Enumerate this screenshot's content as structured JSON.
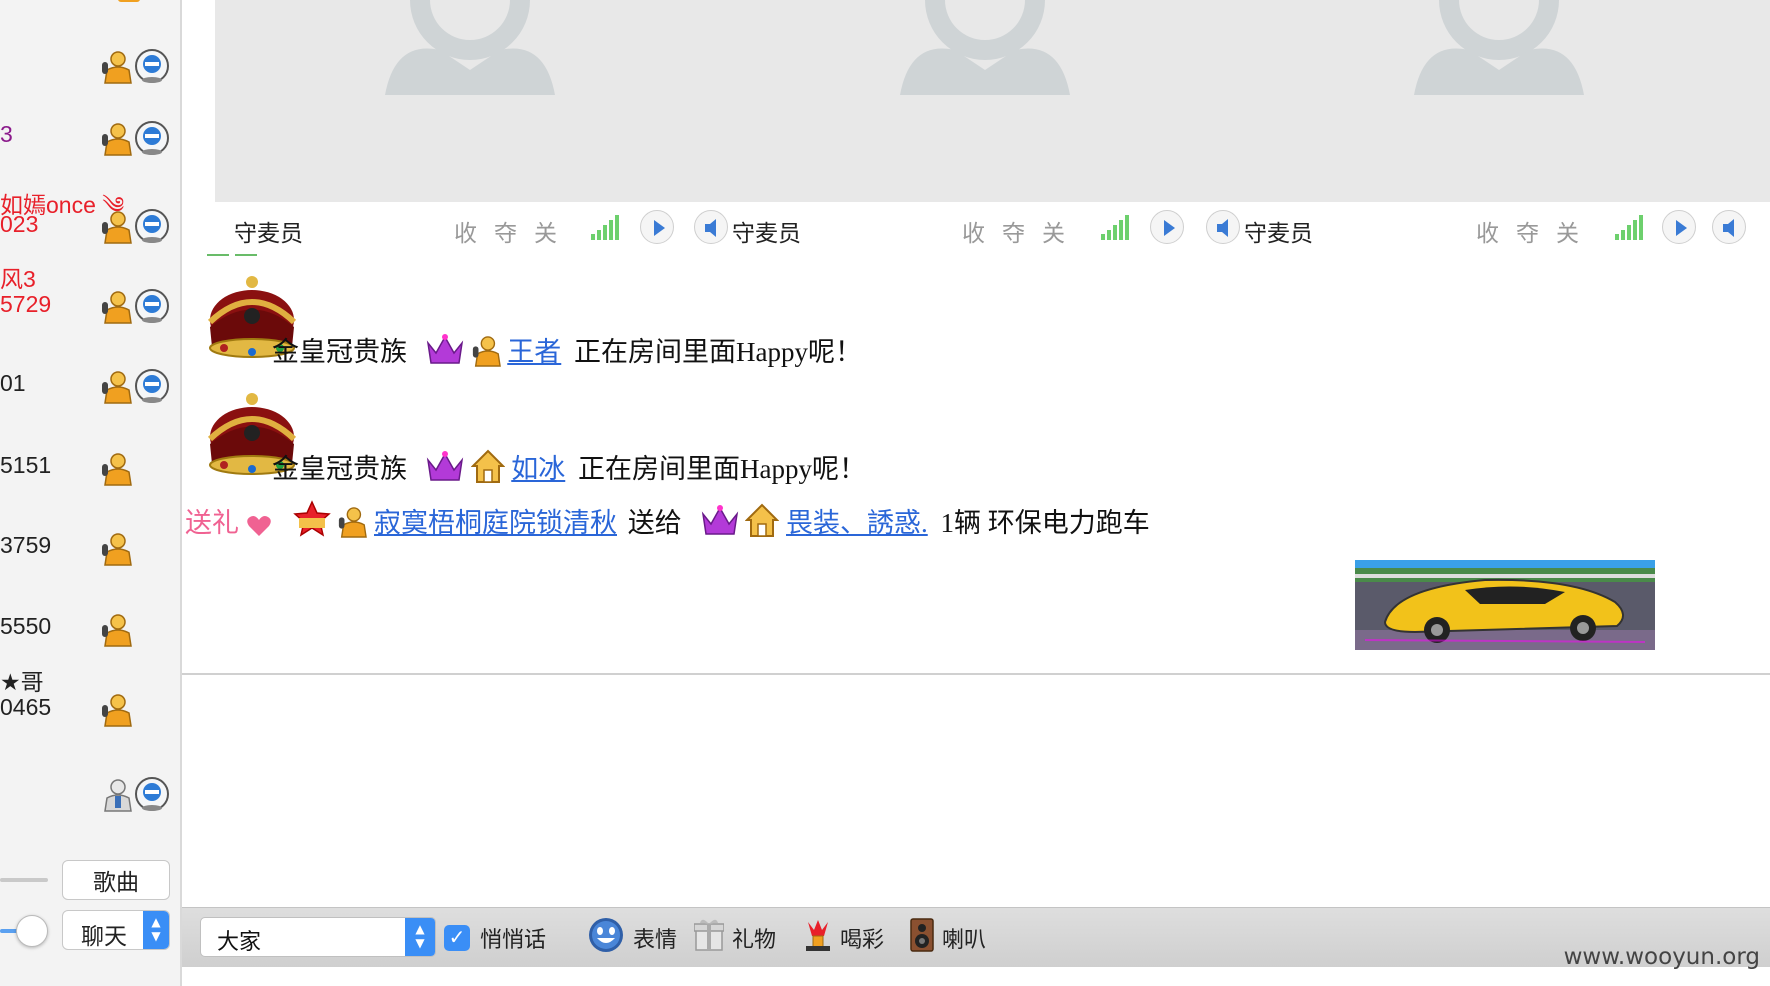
{
  "user_list": {
    "items": [
      {
        "name": "",
        "has_mic": true,
        "has_cam": true
      },
      {
        "name": "3",
        "color": "purple",
        "has_mic": true,
        "has_cam": true
      },
      {
        "name": "如嫣once ༄",
        "name2": "023",
        "color": "red",
        "has_mic": true,
        "has_cam": true
      },
      {
        "name": "风3",
        "name2": "5729",
        "color": "red",
        "has_mic": true,
        "has_cam": true
      },
      {
        "name": "01",
        "color": "dark",
        "has_mic": true,
        "has_cam": true
      },
      {
        "name": "5151",
        "color": "dark",
        "has_mic": true,
        "has_cam": false
      },
      {
        "name": "3759",
        "color": "dark",
        "has_mic": true,
        "has_cam": false
      },
      {
        "name": "5550",
        "color": "dark",
        "has_mic": true,
        "has_cam": false
      },
      {
        "name": "★哥",
        "name2": "0465",
        "color": "dark",
        "has_mic": true,
        "has_cam": false
      },
      {
        "name": "",
        "has_mic": true,
        "has_cam": true
      }
    ],
    "song_button": "歌曲",
    "chat_select": "聊天"
  },
  "mic_bar": {
    "slots": [
      {
        "label": "守麦员",
        "controls": [
          "收",
          "夺",
          "关"
        ]
      },
      {
        "label": "守麦员",
        "controls": [
          "收",
          "夺",
          "关"
        ]
      },
      {
        "label": "守麦员",
        "controls": [
          "收",
          "夺",
          "关"
        ]
      }
    ]
  },
  "chat": {
    "messages": [
      {
        "type": "enter",
        "rank": "金皇冠贵族",
        "user": "王者",
        "text": "正在房间里面Happy呢！"
      },
      {
        "type": "enter",
        "rank": "金皇冠贵族",
        "user": "如冰",
        "text": "正在房间里面Happy呢！"
      },
      {
        "type": "gift",
        "tag": "送礼",
        "from": "寂寞梧桐庭院锁清秋",
        "verb": "送给",
        "to": "畏装、誘惑.",
        "gift": "1辆 环保电力跑车"
      }
    ]
  },
  "toolbar": {
    "target": "大家",
    "whisper_label": "悄悄话",
    "emoji_label": "表情",
    "gift_label": "礼物",
    "cheer_label": "喝彩",
    "speaker_label": "喇叭"
  },
  "watermark": "www.wooyun.org",
  "colors": {
    "accent": "#3a8ef6",
    "link": "#2a66d8",
    "gift_tag": "#f06292",
    "name_red": "#e8202a"
  }
}
